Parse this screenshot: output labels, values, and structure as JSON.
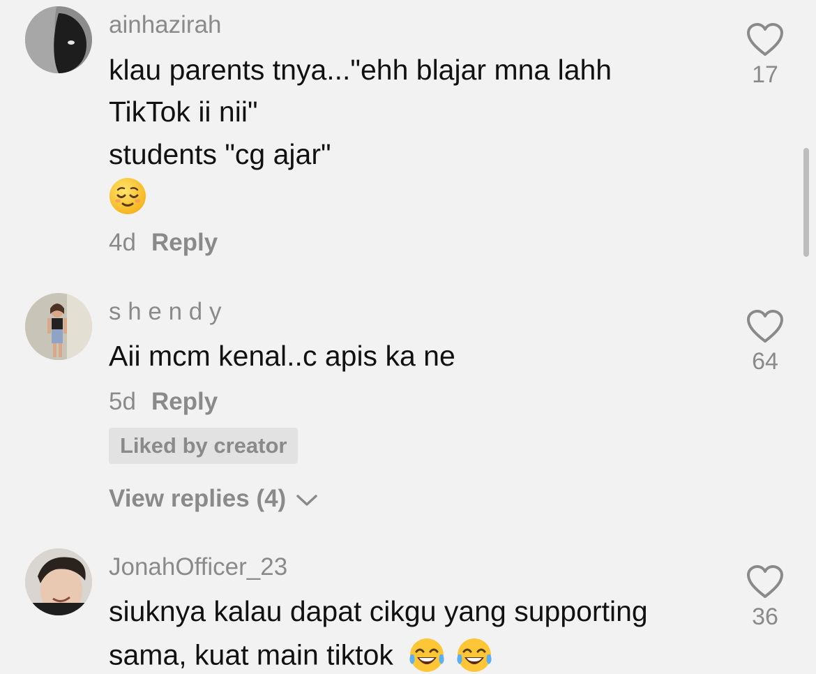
{
  "comments": [
    {
      "username": "ainhazirah",
      "lines": [
        "klau parents tnya...\"ehh blajar mna lahh",
        "TikTok ii nii\"",
        "students \"cg ajar\""
      ],
      "emoji": "relieved-face",
      "age": "4d",
      "reply_label": "Reply",
      "likes": "17"
    },
    {
      "username": "s h e n d y",
      "lines": [
        "Aii mcm kenal..c apis ka ne"
      ],
      "age": "5d",
      "reply_label": "Reply",
      "badge": "Liked by creator",
      "view_replies": "View replies (4)",
      "likes": "64"
    },
    {
      "username": "JonahOfficer_23",
      "lines": [
        "siuknya kalau dapat cikgu yang supporting",
        "sama, kuat main tiktok"
      ],
      "emoji": "face-with-tears-of-joy",
      "likes": "36"
    }
  ],
  "colors": {
    "background": "#f2f2f2",
    "text": "#111111",
    "muted": "#8a8a8a",
    "badge_bg": "#e2e2e2"
  },
  "icons": {
    "like": "heart-outline-icon",
    "expand": "chevron-down-icon"
  }
}
